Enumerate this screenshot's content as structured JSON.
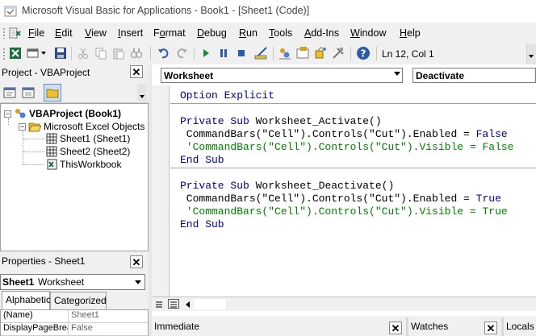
{
  "window": {
    "title": "Microsoft Visual Basic for Applications - Book1 - [Sheet1 (Code)]"
  },
  "menu": {
    "items": [
      {
        "label": "File",
        "underline": "F",
        "rest": "ile"
      },
      {
        "label": "Edit",
        "underline": "E",
        "rest": "dit"
      },
      {
        "label": "View",
        "underline": "V",
        "rest": "iew"
      },
      {
        "label": "Insert",
        "underline": "I",
        "rest": "nsert"
      },
      {
        "label": "Format",
        "underline": "o",
        "prefix": "F",
        "rest": "rmat"
      },
      {
        "label": "Debug",
        "underline": "D",
        "rest": "ebug"
      },
      {
        "label": "Run",
        "underline": "R",
        "rest": "un"
      },
      {
        "label": "Tools",
        "underline": "T",
        "rest": "ools"
      },
      {
        "label": "Add-Ins",
        "underline": "A",
        "rest": "dd-Ins"
      },
      {
        "label": "Window",
        "underline": "W",
        "rest": "indow"
      },
      {
        "label": "Help",
        "underline": "H",
        "rest": "elp"
      }
    ]
  },
  "toolbar": {
    "icons": [
      "view-excel-icon",
      "insert-module-icon",
      "save-icon",
      "cut-icon",
      "copy-icon",
      "paste-icon",
      "find-icon",
      "undo-icon",
      "redo-icon",
      "run-icon",
      "break-icon",
      "reset-icon",
      "design-mode-icon",
      "project-explorer-icon",
      "properties-window-icon",
      "object-browser-icon",
      "toolbox-icon",
      "help-icon"
    ],
    "cursor_position": "Ln 12, Col 1"
  },
  "project_panel": {
    "title": "Project - VBAProject",
    "close": "✕",
    "tree": [
      {
        "label": "VBAProject (Book1)",
        "level": 0,
        "bold": true
      },
      {
        "label": "Microsoft Excel Objects",
        "level": 1,
        "bold": false
      },
      {
        "label": "Sheet1 (Sheet1)",
        "level": 2,
        "bold": false
      },
      {
        "label": "Sheet2 (Sheet2)",
        "level": 2,
        "bold": false
      },
      {
        "label": "ThisWorkbook",
        "level": 2,
        "bold": false
      }
    ]
  },
  "properties_panel": {
    "title": "Properties - Sheet1",
    "close": "✕",
    "object_name": "Sheet1",
    "object_type": "Worksheet",
    "tabs": [
      "Alphabetic",
      "Categorized"
    ],
    "active_tab": "Alphabetic",
    "rows": [
      {
        "name": "(Name)",
        "value": "Sheet1"
      },
      {
        "name": "DisplayPageBreaks",
        "value": "False"
      }
    ]
  },
  "code_window": {
    "object_combo": "Worksheet",
    "procedure_combo": "Deactivate",
    "lines": [
      {
        "type": "kw",
        "text": "Option Explicit",
        "sep_after": true
      },
      {
        "type": "blank",
        "text": ""
      },
      {
        "type": "mixed",
        "kw": "Private Sub",
        "rest": " Worksheet_Activate()"
      },
      {
        "type": "mixed",
        "kw": "",
        "rest": " CommandBars(\"Cell\").Controls(\"Cut\").Enabled = ",
        "kw2": "False"
      },
      {
        "type": "cm",
        "text": " 'CommandBars(\"Cell\").Controls(\"Cut\").Visible = False"
      },
      {
        "type": "kw",
        "text": "End Sub",
        "sep_after": true
      },
      {
        "type": "blank",
        "text": ""
      },
      {
        "type": "mixed",
        "kw": "Private Sub",
        "rest": " Worksheet_Deactivate()"
      },
      {
        "type": "mixed",
        "kw": "",
        "rest": " CommandBars(\"Cell\").Controls(\"Cut\").Enabled = ",
        "kw2": "True"
      },
      {
        "type": "cm",
        "text": " 'CommandBars(\"Cell\").Controls(\"Cut\").Visible = True"
      },
      {
        "type": "kw",
        "text": "End Sub"
      }
    ]
  },
  "bottom_panes": {
    "immediate": "Immediate",
    "watches": "Watches",
    "locals": "Locals",
    "close": "✕"
  },
  "colors": {
    "keyword": "#00008b",
    "comment": "#008000",
    "panel_bg": "#f0f0f0"
  }
}
